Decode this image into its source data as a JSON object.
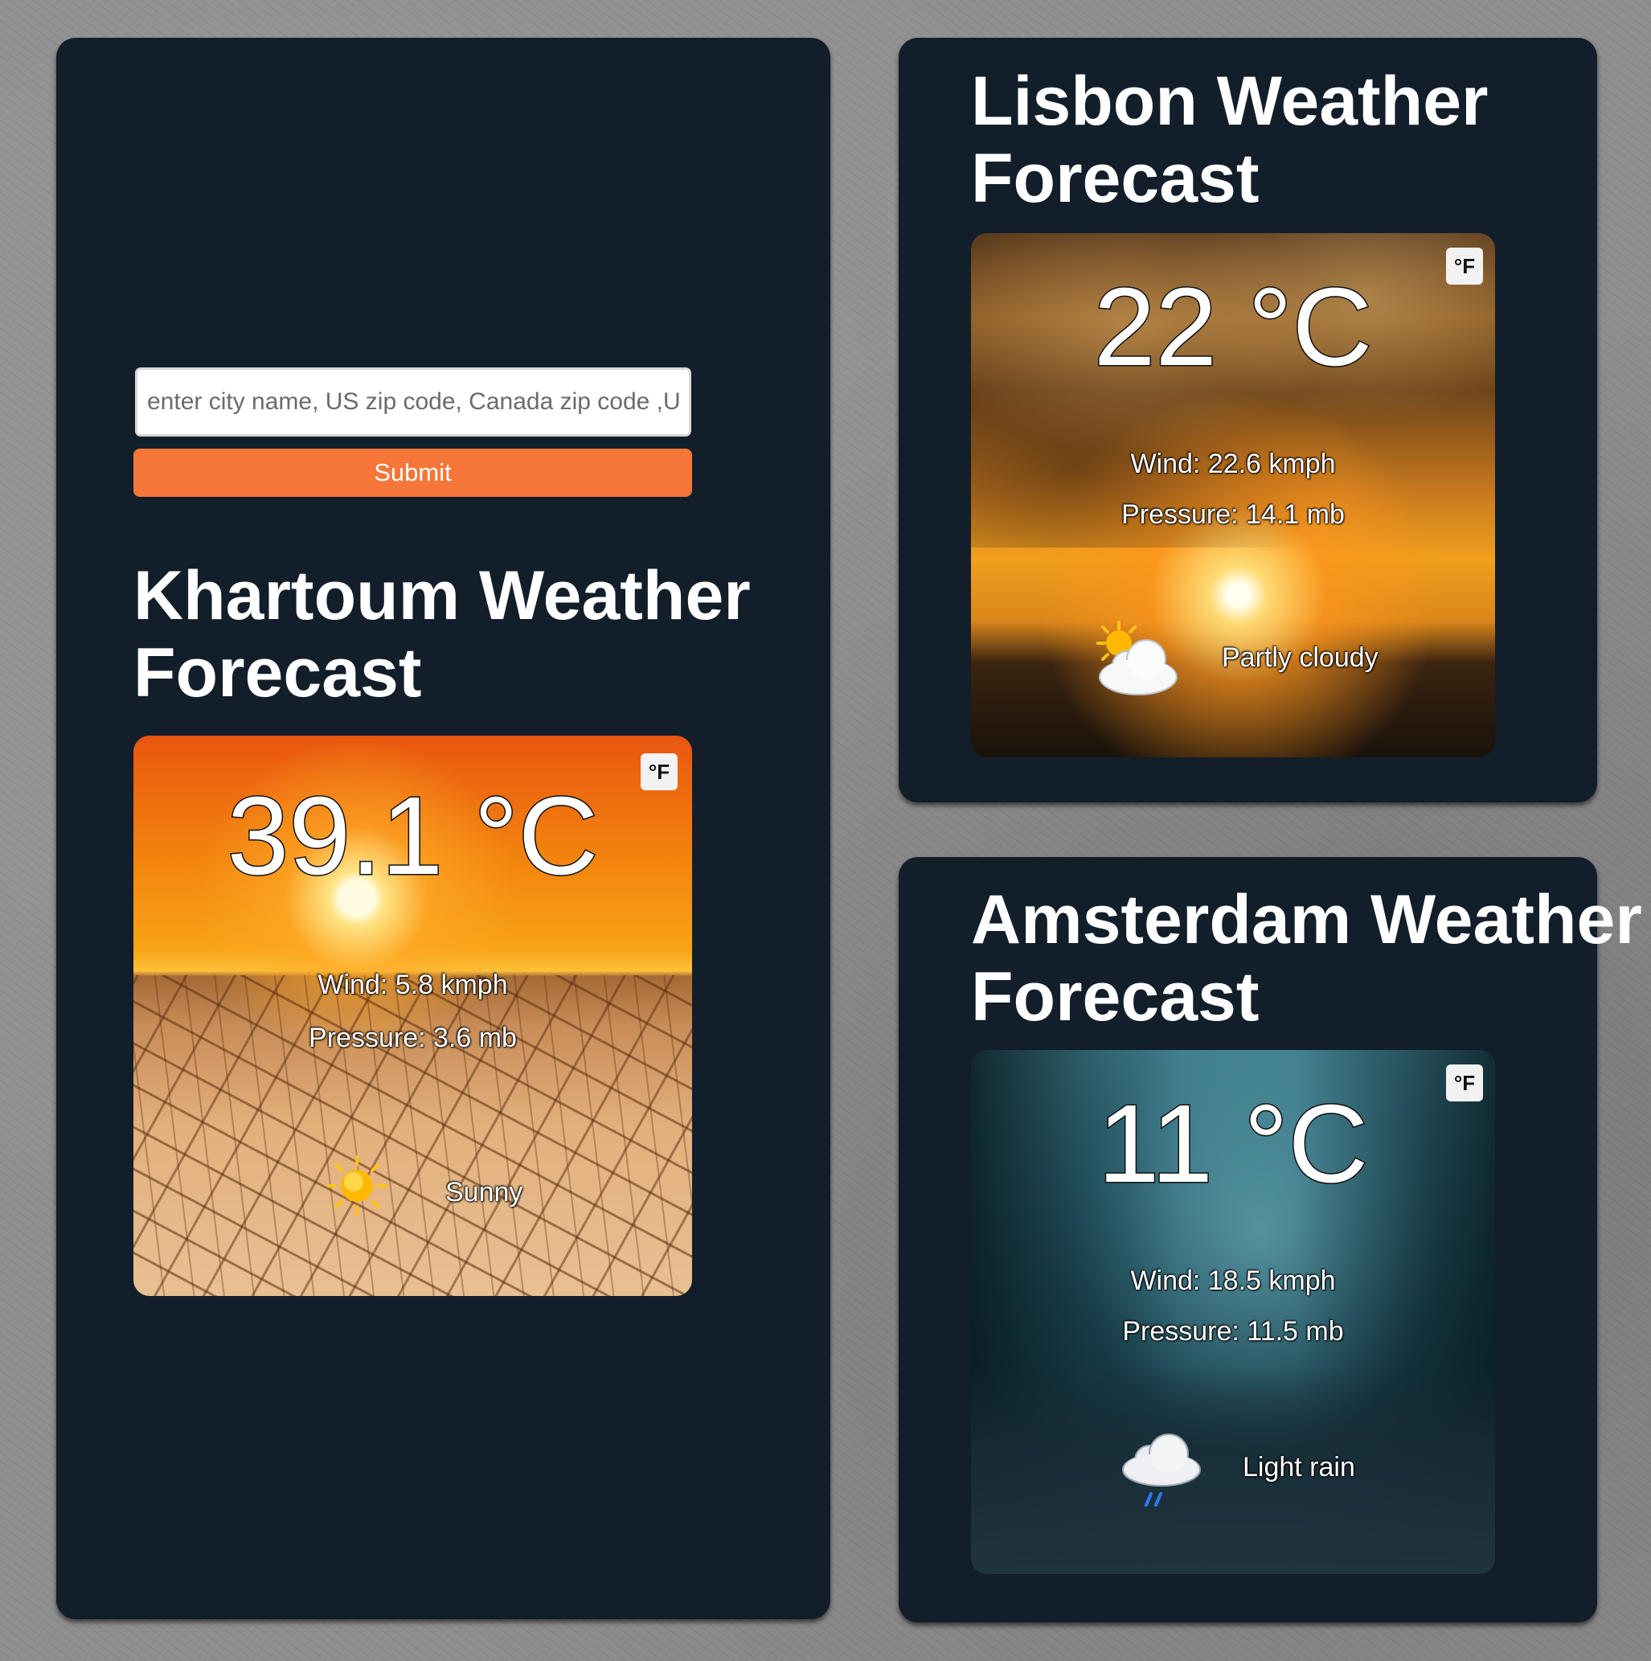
{
  "search": {
    "placeholder": "enter city name, US zip code, Canada zip code ,UK postcode",
    "submit_label": "Submit"
  },
  "cities": {
    "khartoum": {
      "heading_line1": "Khartoum Weather",
      "heading_line2": "Forecast",
      "unit_toggle": "°F",
      "temperature": "39.1 °C",
      "wind": "Wind: 5.8 kmph",
      "pressure": "Pressure: 3.6 mb",
      "condition": "Sunny",
      "icon": "sun-icon"
    },
    "lisbon": {
      "heading_line1": "Lisbon Weather",
      "heading_line2": "Forecast",
      "unit_toggle": "°F",
      "temperature": "22 °C",
      "wind": "Wind: 22.6 kmph",
      "pressure": "Pressure: 14.1 mb",
      "condition": "Partly cloudy",
      "icon": "partly-cloudy-icon"
    },
    "amsterdam": {
      "heading_line1": "Amsterdam Weather",
      "heading_line2": "Forecast",
      "unit_toggle": "°F",
      "temperature": "11 °C",
      "wind": "Wind: 18.5 kmph",
      "pressure": "Pressure: 11.5 mb",
      "condition": "Light rain",
      "icon": "light-rain-icon"
    }
  },
  "colors": {
    "panel_background": "#121e2a",
    "submit_button": "#f57638",
    "page_background": "#8e8e8e"
  }
}
